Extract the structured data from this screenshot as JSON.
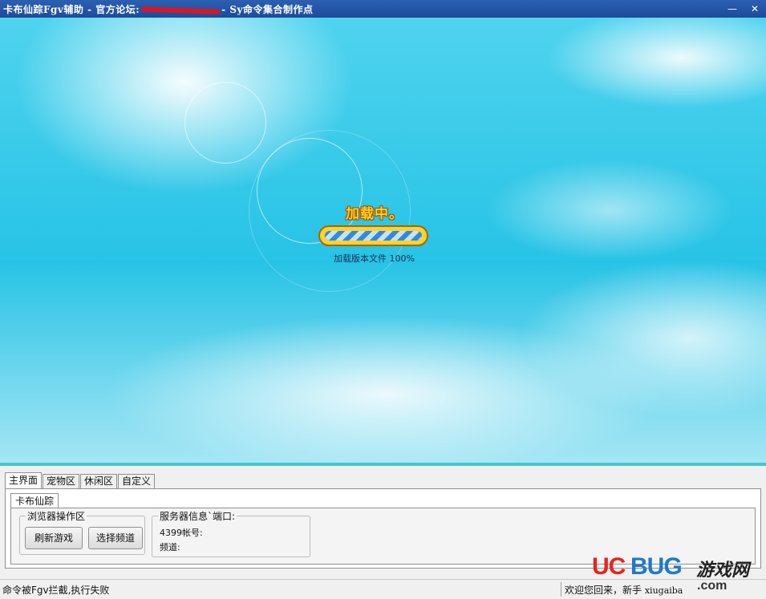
{
  "window": {
    "title_prefix": "卡布仙踪Fgv辅助 - 官方论坛:",
    "title_suffix": "- Sy命令集合制作点",
    "minimize_glyph": "—",
    "close_glyph": "✕"
  },
  "game": {
    "loading_title": "加载中。",
    "loading_text": "加载版本文件 100%",
    "progress": 1.0
  },
  "tabs": [
    "主界面",
    "宠物区",
    "休闲区",
    "自定义"
  ],
  "active_tab": 0,
  "subtab": "卡布仙踪",
  "browser_group": {
    "legend": "浏览器操作区",
    "refresh_button": "刷新游戏",
    "channel_button": "选择频道"
  },
  "server_group": {
    "legend": "服务器信息`端口:",
    "account_label": "4399帐号:",
    "channel_label": "频道:"
  },
  "status": {
    "left": "命令被Fgv拦截,执行失败",
    "right_greeting": "欢迎您回来，新手",
    "right_user": "xiugaiba"
  },
  "watermark": {
    "uc": "UC",
    "bug": "BUG",
    "cn": "游戏网",
    "com": ".com"
  },
  "colors": {
    "titlebar": "#1d4c9a",
    "accent_line": "#45c7cc",
    "loading_title": "#ffd21a",
    "redaction": "#e0141c"
  }
}
